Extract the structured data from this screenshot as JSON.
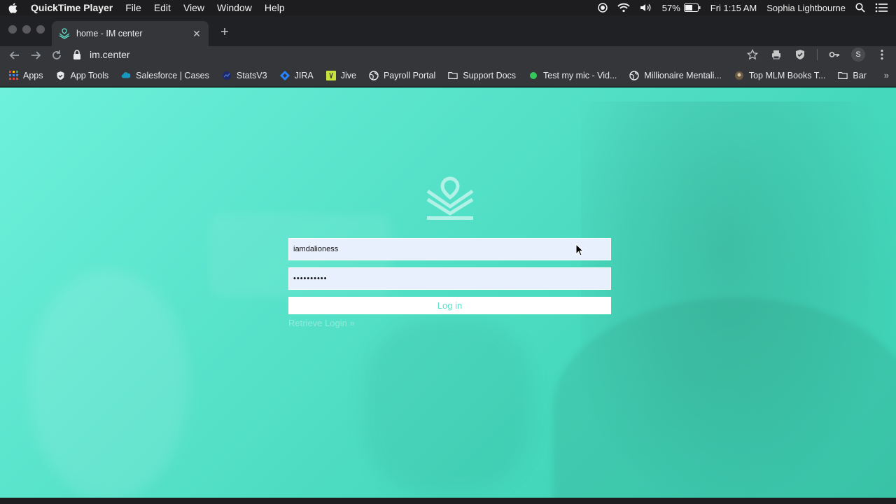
{
  "menubar": {
    "app_name": "QuickTime Player",
    "menus": [
      "File",
      "Edit",
      "View",
      "Window",
      "Help"
    ],
    "battery_percent": "57%",
    "clock": "Fri 1:15 AM",
    "user_name": "Sophia Lightbourne"
  },
  "browser": {
    "tab_title": "home - IM center",
    "url": "im.center",
    "profile_initial": "S",
    "bookmarks": [
      {
        "label": "Apps",
        "icon": "apps-grid-icon"
      },
      {
        "label": "App Tools",
        "icon": "shield-icon"
      },
      {
        "label": "Salesforce | Cases",
        "icon": "cloud-icon"
      },
      {
        "label": "StatsV3",
        "icon": "stats-icon"
      },
      {
        "label": "JIRA",
        "icon": "jira-icon"
      },
      {
        "label": "Jive",
        "icon": "jive-icon"
      },
      {
        "label": "Payroll Portal",
        "icon": "globe-icon"
      },
      {
        "label": "Support Docs",
        "icon": "folder-icon"
      },
      {
        "label": "Test my mic - Vid...",
        "icon": "mic-icon"
      },
      {
        "label": "Millionaire Mentali...",
        "icon": "globe-icon"
      },
      {
        "label": "Top MLM Books T...",
        "icon": "book-icon"
      },
      {
        "label": "Bar",
        "icon": "folder-icon"
      }
    ],
    "more_label": "»"
  },
  "login": {
    "username_value": "iamdalioness",
    "password_value": "••••••••••",
    "login_button": "Log in",
    "retrieve_link": "Retrieve Login »"
  },
  "colors": {
    "accent": "#5fe0ca",
    "background_teal": "#52dec6",
    "input_bg": "#e8f0fe"
  }
}
